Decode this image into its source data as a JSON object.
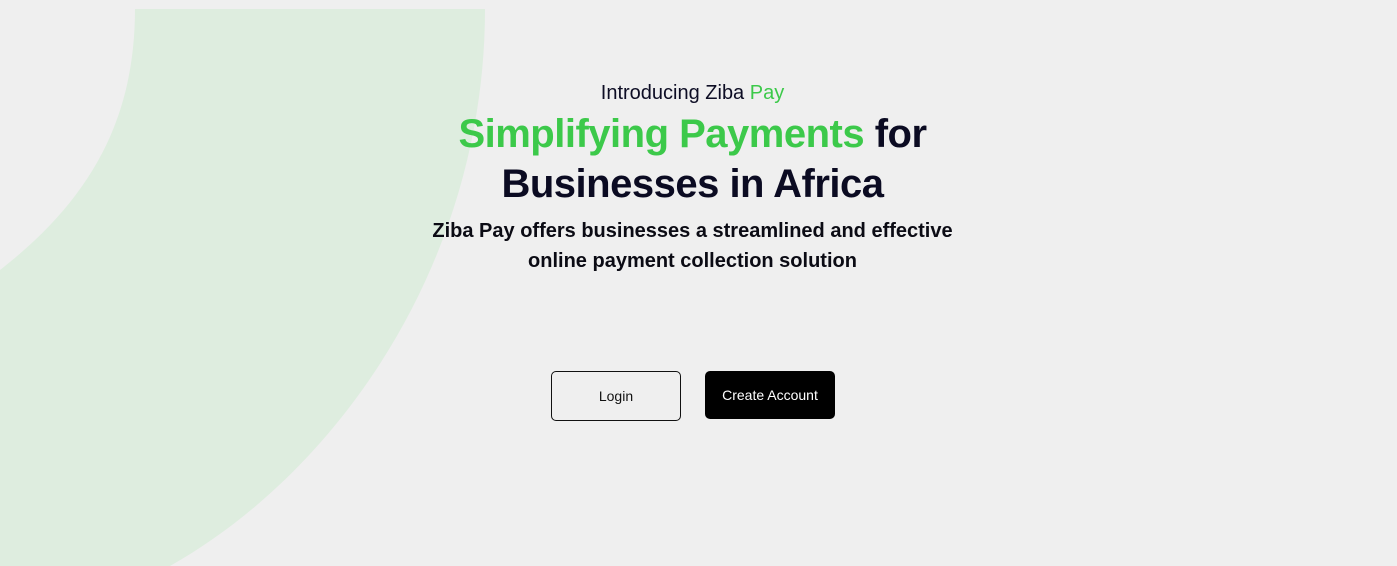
{
  "hero": {
    "intro_prefix": "Introducing Ziba",
    "intro_accent": "Pay",
    "headline_accent": "Simplifying Payments",
    "headline_rest_line1": "for",
    "headline_line2": "Businesses in Africa",
    "subtitle": "Ziba Pay offers businesses a streamlined and effective online payment collection solution"
  },
  "actions": {
    "login_label": "Login",
    "create_account_label": "Create Account"
  },
  "colors": {
    "accent": "#3cc94a",
    "background": "#efefef",
    "decor_shape": "#deeddf",
    "primary_button": "#000000"
  }
}
